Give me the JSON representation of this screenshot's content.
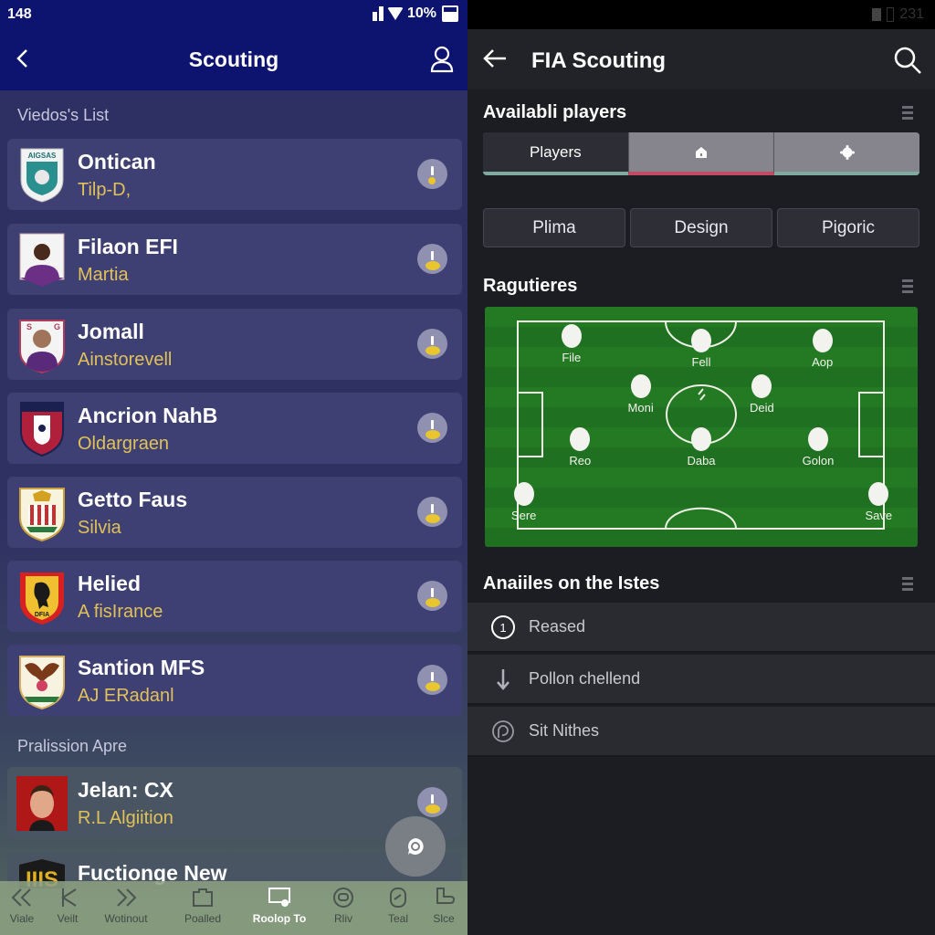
{
  "left_app": {
    "status_bar": {
      "time": "148",
      "battery": "10%"
    },
    "header": {
      "title": "Scouting",
      "back_icon": "chevron-left-icon",
      "profile_icon": "user-icon"
    },
    "sections": [
      {
        "label": "Viedos's List"
      },
      {
        "label": "Pralission Apre"
      }
    ],
    "players": [
      {
        "name": "Ontican",
        "subtitle": "Tilp-D,",
        "crest": "teal-shield-crest",
        "crest_color": "#2a8f8f"
      },
      {
        "name": "Filaon EFI",
        "subtitle": "Martia",
        "crest": "player-portrait-crest",
        "crest_color": "#6b2f86"
      },
      {
        "name": "Jomall",
        "subtitle": "Ainstorevell",
        "crest": "player-portrait-crest",
        "crest_color": "#7a2a5a"
      },
      {
        "name": "Ancrion NahB",
        "subtitle": "Oldargraen",
        "crest": "red-shield-crest",
        "crest_color": "#b0203a"
      },
      {
        "name": "Getto Faus",
        "subtitle": "Silvia",
        "crest": "striped-shield-crest",
        "crest_color": "#c83030"
      },
      {
        "name": "Helied",
        "subtitle": "A fisIrance",
        "crest": "yellow-horse-crest",
        "crest_color": "#e8c030"
      },
      {
        "name": "Santion MFS",
        "subtitle": "AJ ERadanl",
        "crest": "eagle-crest",
        "crest_color": "#7a3a1a"
      }
    ],
    "promoted_players": [
      {
        "name": "Jelan: CX",
        "subtitle": "R.L Algiition",
        "crest": "portrait-red",
        "crest_color": "#b01818"
      },
      {
        "name": "Fuctionge New",
        "subtitle": "",
        "crest": "yellow-black-crest",
        "crest_color": "#e0b020"
      }
    ],
    "fab": {
      "icon": "chat-icon"
    },
    "bottom_nav": [
      {
        "label": "Viale",
        "icon": "double-chevron-left-icon",
        "active": false
      },
      {
        "label": "Veilt",
        "icon": "chevron-left-icon",
        "active": false
      },
      {
        "label": "Wotinout",
        "icon": "double-chevron-right-icon",
        "active": false
      },
      {
        "label": "Poalled",
        "icon": "folder-icon",
        "active": false
      },
      {
        "label": "Roolop To",
        "icon": "screen-icon",
        "active": true
      },
      {
        "label": "Rliv",
        "icon": "circle-badge-icon",
        "active": false
      },
      {
        "label": "Teal",
        "icon": "tag-icon",
        "active": false
      },
      {
        "label": "Slce",
        "icon": "boot-icon",
        "active": false
      }
    ]
  },
  "right_app": {
    "status_bar": {
      "time": "231"
    },
    "header": {
      "title": "FIA Scouting",
      "back_icon": "arrow-left-icon",
      "search_icon": "search-icon"
    },
    "available_section": {
      "title": "Availabli players"
    },
    "segmented_tabs": [
      {
        "label": "Players",
        "icon": null,
        "active": true
      },
      {
        "label": "",
        "icon": "home-icon",
        "active": false
      },
      {
        "label": "",
        "icon": "settings-icon",
        "active": false
      }
    ],
    "filter_chips": [
      "Plima",
      "Design",
      "Pigoric"
    ],
    "formation_section": {
      "title": "Ragutieres"
    },
    "formation_players": [
      {
        "label": "File",
        "pos": [
          0.2,
          0.12
        ]
      },
      {
        "label": "Fell",
        "pos": [
          0.5,
          0.14
        ]
      },
      {
        "label": "Aop",
        "pos": [
          0.78,
          0.14
        ]
      },
      {
        "label": "Moni",
        "pos": [
          0.36,
          0.33
        ]
      },
      {
        "label": "Deid",
        "pos": [
          0.64,
          0.33
        ]
      },
      {
        "label": "Reo",
        "pos": [
          0.22,
          0.55
        ]
      },
      {
        "label": "Daba",
        "pos": [
          0.5,
          0.55
        ]
      },
      {
        "label": "Golon",
        "pos": [
          0.77,
          0.55
        ]
      },
      {
        "label": "Sere",
        "pos": [
          0.09,
          0.78
        ]
      },
      {
        "label": "Save",
        "pos": [
          0.91,
          0.78
        ]
      }
    ],
    "actions_section": {
      "title": "Anaiiles on the Istes"
    },
    "actions": [
      {
        "label": "Reased",
        "icon": "number-one-circle-icon"
      },
      {
        "label": "Pollon chellend",
        "icon": "arrow-down-icon"
      },
      {
        "label": "Sit Nithes",
        "icon": "fingerprint-icon"
      }
    ]
  }
}
